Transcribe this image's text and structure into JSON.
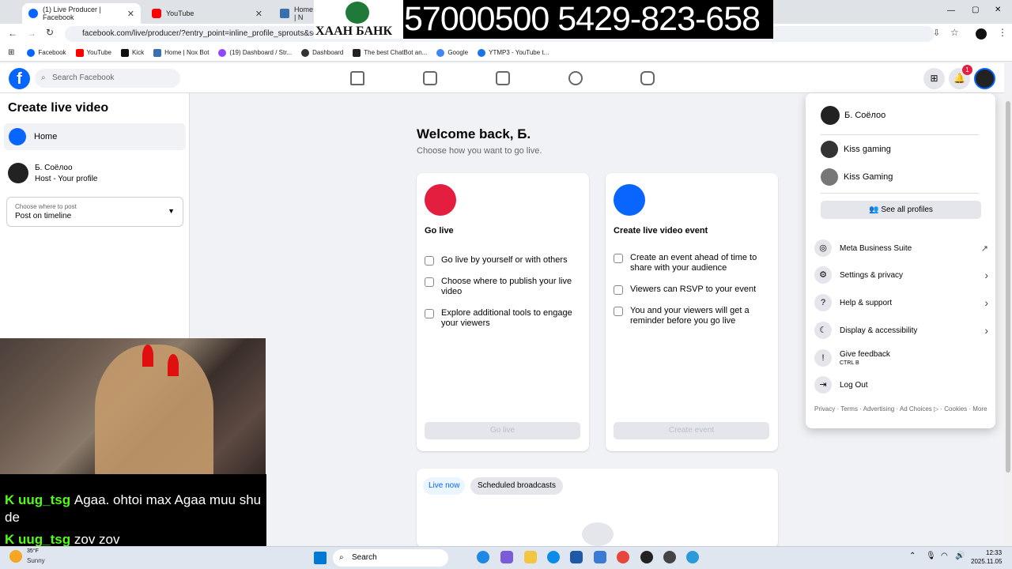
{
  "browser": {
    "tabs": [
      {
        "title": "(1) Live Producer | Facebook",
        "close": "✕"
      },
      {
        "title": "YouTube",
        "close": "✕"
      },
      {
        "title": "Home | N"
      }
    ],
    "url": "facebook.com/live/producer/?entry_point=inline_profile_sprouts&sour",
    "window_controls": [
      "—",
      "▢",
      "✕"
    ],
    "bookmarks": [
      "Facebook",
      "YouTube",
      "Kick",
      "Home | Nox Bot",
      "(19) Dashboard / Str...",
      "Dashboard",
      "The best ChatBot an...",
      "Google",
      "YTMP3 - YouTube t..."
    ]
  },
  "overlay": {
    "bank_name": "ХААН БАНК",
    "bank_number": "57000500 5429-823-658"
  },
  "fb_header": {
    "logo": "f",
    "search_placeholder": "Search Facebook",
    "notification_count": "1"
  },
  "left_panel": {
    "title": "Create live video",
    "home_label": "Home",
    "profile_name": "Б. Соёлоо",
    "profile_role": "Host - Your profile",
    "post_where_label": "Choose where to post",
    "post_where_value": "Post on timeline"
  },
  "main": {
    "welcome": "Welcome back, Б.",
    "subtitle": "Choose how you want to go live.",
    "go_live_card": {
      "title": "Go live",
      "features": [
        "Go live by yourself or with others",
        "Choose where to publish your live video",
        "Explore additional tools to engage your viewers"
      ],
      "button": "Go live"
    },
    "event_card": {
      "title": "Create live video event",
      "features": [
        "Create an event ahead of time to share with your audience",
        "Viewers can RSVP to your event",
        "You and your viewers will get a reminder before you go live"
      ],
      "button": "Create event"
    },
    "tabs": [
      "Live now",
      "Scheduled broadcasts"
    ]
  },
  "dropdown": {
    "profiles": [
      "Б. Соёлоо",
      "Kiss gaming",
      "Kiss Gaming"
    ],
    "see_all": "See all profiles",
    "items": [
      {
        "label": "Meta Business Suite"
      },
      {
        "label": "Settings & privacy"
      },
      {
        "label": "Help & support"
      },
      {
        "label": "Display & accessibility"
      },
      {
        "label": "Give feedback",
        "sub": "CTRL B"
      },
      {
        "label": "Log Out"
      }
    ],
    "footer": "Privacy · Terms · Advertising · Ad Choices ▷ · Cookies · More"
  },
  "chat": {
    "messages": [
      {
        "user": "uug_tsg",
        "text": "Agaa. ohtoi max Agaa muu shu de"
      },
      {
        "user": "uug_tsg",
        "text": "zov zov"
      }
    ],
    "badge": "K"
  },
  "taskbar": {
    "weather_temp": "35°F",
    "weather_desc": "Sunny",
    "search": "Search",
    "time": "12:33",
    "date": "2025.11.05"
  }
}
